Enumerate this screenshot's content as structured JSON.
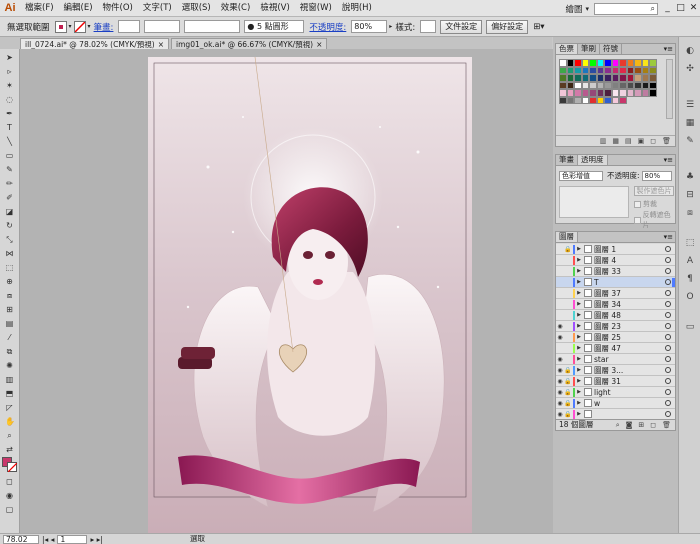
{
  "app": {
    "logo": "Ai",
    "menus": [
      "檔案(F)",
      "編輯(E)",
      "物件(O)",
      "文字(T)",
      "選取(S)",
      "效果(C)",
      "檢視(V)",
      "視窗(W)",
      "說明(H)"
    ],
    "workspace": "繪圖",
    "search_icon": "⌕",
    "window_controls": [
      "_",
      "□",
      "✕"
    ]
  },
  "controlbar": {
    "selection_label": "無選取範圍",
    "stroke_label": "筆畫:",
    "brush_value": "5 點圓形",
    "opacity_label": "不透明度:",
    "opacity_value": "80%",
    "style_label": "樣式:",
    "doc_setup_button": "文件設定",
    "prefs_button": "偏好設定"
  },
  "tabs": [
    {
      "label": "ill_0724.ai* @ 78.02% (CMYK/預視)",
      "close": "×"
    },
    {
      "label": "img01_ok.ai* @ 66.67% (CMYK/預視)",
      "close": "×"
    }
  ],
  "status": {
    "zoom": "78.02",
    "page": "1",
    "text": "選取"
  },
  "swatches": {
    "tabs": [
      "色票",
      "筆刷",
      "符號"
    ],
    "colors": [
      "#ffffff",
      "#000000",
      "#ff0000",
      "#ffff00",
      "#00ff00",
      "#00ffff",
      "#0000ff",
      "#ff00ff",
      "#e83a2c",
      "#f07a1a",
      "#f5b614",
      "#f8e41a",
      "#9cca3c",
      "#3ea84a",
      "#1e9c74",
      "#169ba8",
      "#1a76c0",
      "#2c4ca2",
      "#5a3792",
      "#8b2e8e",
      "#c6296f",
      "#e02a4a",
      "#8c1f1f",
      "#9b5012",
      "#a88012",
      "#8c8c1c",
      "#4e7a26",
      "#1b6b38",
      "#0f6b5a",
      "#0e6a78",
      "#134d86",
      "#1b2f6b",
      "#3a205f",
      "#5b1c5e",
      "#82174a",
      "#a3143a",
      "#c8a07a",
      "#a07850",
      "#7c5a38",
      "#5a3c22",
      "#3c2614",
      "#ffffff",
      "#e6e6e6",
      "#cccccc",
      "#b3b3b3",
      "#999999",
      "#808080",
      "#666666",
      "#4d4d4d",
      "#333333",
      "#1a1a1a",
      "#000000",
      "#f2c6d8",
      "#e8a0c0",
      "#d27aa8",
      "#b85a8e",
      "#964878",
      "#70325c",
      "#4e2040",
      "#f8e6ee",
      "#efd2e0",
      "#e2b6cc",
      "#d49ab8",
      "#bd7ca0",
      "#000000",
      "#3a3a3a",
      "#757575",
      "#b0b0b0",
      "#ffffff",
      "#e03030",
      "#ffd000",
      "#3060d0",
      "#f5c9dc",
      "#c8376b"
    ]
  },
  "transparency": {
    "tabs": [
      "筆畫",
      "透明度"
    ],
    "blend_mode": "色彩增值",
    "opacity_label": "不透明度:",
    "opacity_value": "80%",
    "make_mask_button": "製作遮色片",
    "clip_label": "剪裁",
    "invert_label": "反轉遮色片"
  },
  "layers": {
    "tab": "圖層",
    "count_label": "18 個圖層",
    "rows": [
      {
        "name": "圖層 1",
        "color": "#4f7bff",
        "eye": false,
        "lock": true,
        "selected": false
      },
      {
        "name": "圖層 4",
        "color": "#ff4f4f",
        "eye": false,
        "lock": false,
        "selected": false
      },
      {
        "name": "圖層 33",
        "color": "#4fd24f",
        "eye": false,
        "lock": false,
        "selected": false
      },
      {
        "name": "T",
        "color": "#4f7bff",
        "eye": false,
        "lock": false,
        "selected": true
      },
      {
        "name": "圖層 37",
        "color": "#ffd24f",
        "eye": false,
        "lock": false,
        "selected": false
      },
      {
        "name": "圖層 34",
        "color": "#ff4fd2",
        "eye": false,
        "lock": false,
        "selected": false
      },
      {
        "name": "圖層 48",
        "color": "#4fd2d2",
        "eye": false,
        "lock": false,
        "selected": false
      },
      {
        "name": "圖層 23",
        "color": "#a04fff",
        "eye": true,
        "lock": false,
        "selected": false
      },
      {
        "name": "圖層 25",
        "color": "#ff9a4f",
        "eye": true,
        "lock": false,
        "selected": false
      },
      {
        "name": "圖層 47",
        "color": "#9aff4f",
        "eye": false,
        "lock": false,
        "selected": false
      },
      {
        "name": "star",
        "color": "#ff4f9a",
        "eye": true,
        "lock": false,
        "selected": false
      },
      {
        "name": "圖層 3...",
        "color": "#4f9aff",
        "eye": true,
        "lock": true,
        "selected": false
      },
      {
        "name": "圖層 31",
        "color": "#ff4f4f",
        "eye": true,
        "lock": true,
        "selected": false
      },
      {
        "name": "light",
        "color": "#4fd24f",
        "eye": true,
        "lock": true,
        "selected": false
      },
      {
        "name": "w",
        "color": "#4f7bff",
        "eye": true,
        "lock": true,
        "selected": false
      },
      {
        "name": "",
        "color": "#ff4fd2",
        "eye": true,
        "lock": true,
        "selected": false
      }
    ]
  }
}
